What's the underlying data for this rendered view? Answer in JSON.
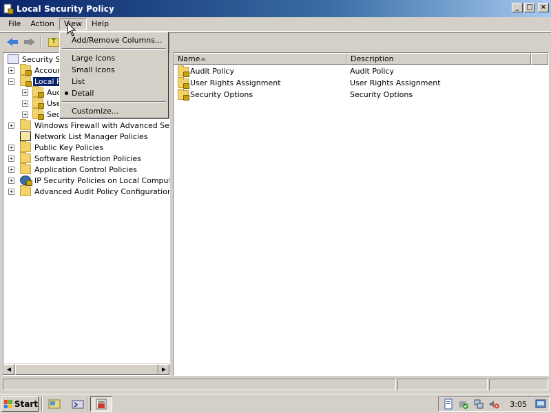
{
  "window": {
    "title": "Local Security Policy",
    "buttons": {
      "minimize": "_",
      "maximize": "□",
      "close": "×"
    }
  },
  "menubar": [
    {
      "label": "File"
    },
    {
      "label": "Action"
    },
    {
      "label": "View",
      "active": true
    },
    {
      "label": "Help"
    }
  ],
  "view_menu": {
    "items": [
      {
        "label": "Add/Remove Columns..."
      },
      {
        "label": "Large Icons"
      },
      {
        "label": "Small Icons"
      },
      {
        "label": "List"
      },
      {
        "label": "Detail",
        "checked": true
      },
      {
        "label": "Customize..."
      }
    ]
  },
  "tree": [
    {
      "label": "Security Se",
      "icon": "policy-icon",
      "level": 0
    },
    {
      "label": "Accoun",
      "icon": "locked-folder-icon",
      "level": 1,
      "expander": "+"
    },
    {
      "label": "Local Po",
      "icon": "locked-folder-icon",
      "level": 1,
      "expander": "−",
      "selected": true
    },
    {
      "label": "Aud",
      "icon": "locked-folder-icon",
      "level": 2,
      "expander": "+"
    },
    {
      "label": "Use",
      "icon": "locked-folder-icon",
      "level": 2,
      "expander": "+"
    },
    {
      "label": "Sec",
      "icon": "locked-folder-icon",
      "level": 2,
      "expander": "+"
    },
    {
      "label": "Windows Firewall with Advanced Security",
      "icon": "folder-icon",
      "level": 1,
      "expander": "+"
    },
    {
      "label": "Network List Manager Policies",
      "icon": "network-list-icon",
      "level": 1
    },
    {
      "label": "Public Key Policies",
      "icon": "folder-icon",
      "level": 1,
      "expander": "+"
    },
    {
      "label": "Software Restriction Policies",
      "icon": "folder-icon",
      "level": 1,
      "expander": "+"
    },
    {
      "label": "Application Control Policies",
      "icon": "folder-icon",
      "level": 1,
      "expander": "+"
    },
    {
      "label": "IP Security Policies on Local Computer",
      "icon": "ip-security-icon",
      "level": 1,
      "expander": "+"
    },
    {
      "label": "Advanced Audit Policy Configuration",
      "icon": "folder-icon",
      "level": 1,
      "expander": "+"
    }
  ],
  "list": {
    "columns": [
      "Name",
      "Description"
    ],
    "rows": [
      {
        "name": "Audit Policy",
        "description": "Audit Policy"
      },
      {
        "name": "User Rights Assignment",
        "description": "User Rights Assignment"
      },
      {
        "name": "Security Options",
        "description": "Security Options"
      }
    ]
  },
  "scrollbar": {
    "left": "◀",
    "right": "▶"
  },
  "taskbar": {
    "start_label": "Start",
    "clock": "3:05"
  },
  "colors": {
    "titlebar": "#0a246a",
    "selection": "#0a246a",
    "face": "#d4d0c8"
  }
}
